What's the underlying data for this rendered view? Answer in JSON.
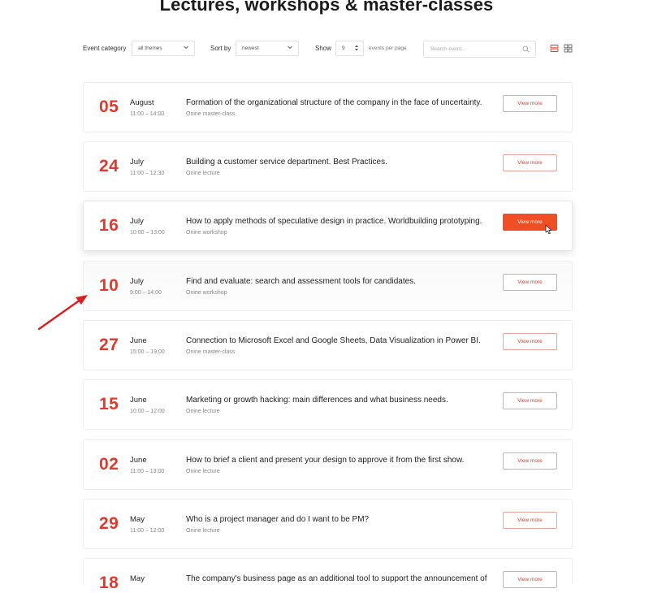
{
  "page": {
    "title": "Lectures, workshops & master-classes"
  },
  "filters": {
    "category_label": "Event category",
    "category_value": "all themes",
    "sort_label": "Sort by",
    "sort_value": "newest",
    "show_label": "Show",
    "show_value": "9",
    "per_page_label": "events per page",
    "search_placeholder": "Search event...",
    "active_view": "list"
  },
  "events": [
    {
      "day": "05",
      "month": "August",
      "time": "11:00 – 14:00",
      "title": "Formation of the organizational structure of the company in the face of uncertainty.",
      "type": "Onine master-class",
      "button": "View more"
    },
    {
      "day": "24",
      "month": "July",
      "time": "11:00 – 12:30",
      "title": "Building a customer service department. Best Practices.",
      "type": "Onine lecture",
      "button": "View more"
    },
    {
      "day": "16",
      "month": "July",
      "time": "10:00 – 13:00",
      "title": "How to apply methods of speculative design in practice. Worldbuilding prototyping.",
      "type": "Onine workshop",
      "button": "View more"
    },
    {
      "day": "10",
      "month": "July",
      "time": "9:00 – 14:00",
      "title": "Find and evaluate: search and assessment tools for candidates.",
      "type": "Onine workshop",
      "button": "View more"
    },
    {
      "day": "27",
      "month": "June",
      "time": "15:00 – 19:00",
      "title": "Connection to Microsoft Excel and Google Sheets, Data Visualization in Power BI.",
      "type": "Onine master-class",
      "button": "View more"
    },
    {
      "day": "15",
      "month": "June",
      "time": "10:00 – 12:00",
      "title": "Marketing or growth hacking: main differences and what business needs.",
      "type": "Onine lecture",
      "button": "View more"
    },
    {
      "day": "02",
      "month": "June",
      "time": "11:00 – 13:00",
      "title": "How to brief a client and present your design to approve it from the first show.",
      "type": "Onine lecture",
      "button": "View more"
    },
    {
      "day": "29",
      "month": "May",
      "time": "11:00 – 12:00",
      "title": "Who is a project manager and do I want to be PM?",
      "type": "Onine lecture",
      "button": "View more"
    },
    {
      "day": "18",
      "month": "May",
      "time": "",
      "title": "The company's business page as an additional tool to support the announcement of",
      "type": "",
      "button": "View more"
    }
  ],
  "colors": {
    "accent": "#e1392b",
    "button_active": "#f04e24",
    "annotation_arrow": "#d9201f"
  }
}
